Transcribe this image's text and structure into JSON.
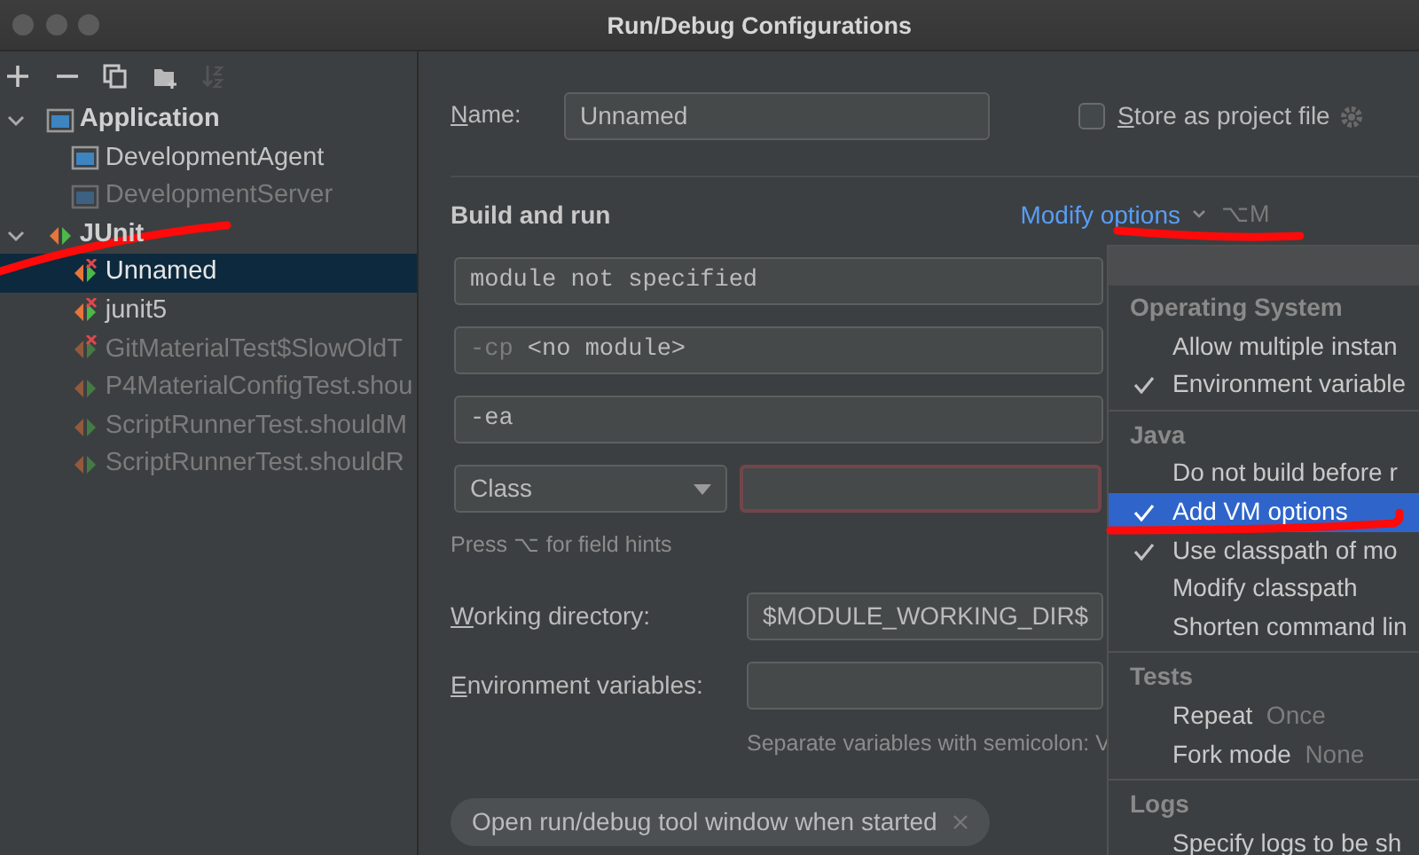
{
  "window": {
    "title": "Run/Debug Configurations"
  },
  "toolbar": [
    {
      "kind": "add",
      "disabled": false
    },
    {
      "kind": "remove",
      "disabled": false
    },
    {
      "kind": "copy",
      "disabled": false
    },
    {
      "kind": "folder",
      "disabled": false
    },
    {
      "kind": "sort",
      "disabled": true
    }
  ],
  "tree": [
    {
      "label": "Application",
      "kind": "application",
      "expanded": true,
      "children": [
        {
          "label": "DevelopmentAgent",
          "kind": "application",
          "dimmed": false,
          "error": false,
          "selected": false
        },
        {
          "label": "DevelopmentServer",
          "kind": "application",
          "dimmed": true,
          "error": false,
          "selected": false
        }
      ]
    },
    {
      "label": "JUnit",
      "kind": "junit",
      "expanded": true,
      "children": [
        {
          "label": "Unnamed",
          "kind": "junit",
          "dimmed": false,
          "error": true,
          "selected": true
        },
        {
          "label": "junit5",
          "kind": "junit",
          "dimmed": false,
          "error": true,
          "selected": false
        },
        {
          "label": "GitMaterialTest$SlowOldT",
          "kind": "junit",
          "dimmed": true,
          "error": true,
          "selected": false
        },
        {
          "label": "P4MaterialConfigTest.shou",
          "kind": "junit",
          "dimmed": true,
          "error": false,
          "selected": false
        },
        {
          "label": "ScriptRunnerTest.shouldM",
          "kind": "junit",
          "dimmed": true,
          "error": false,
          "selected": false
        },
        {
          "label": "ScriptRunnerTest.shouldR",
          "kind": "junit",
          "dimmed": true,
          "error": false,
          "selected": false
        }
      ]
    }
  ],
  "form": {
    "name": {
      "label": "Name:",
      "value": "Unnamed"
    },
    "store": {
      "label": "Store as project file",
      "checked": false
    },
    "section": "Build and run",
    "modify": {
      "label": "Modify options",
      "shortcut": "⌥M"
    },
    "module": "module not specified",
    "classpath": {
      "prefix": "-cp",
      "value": "<no module>"
    },
    "vm_options": "-ea",
    "target": {
      "value": "Class",
      "error": true
    },
    "field_hint": "Press ⌥ for field hints",
    "working_dir": {
      "label": "Working directory:",
      "value": "$MODULE_WORKING_DIR$"
    },
    "env": {
      "label": "Environment variables:",
      "hint": "Separate variables with semicolon: V"
    },
    "chips": [
      {
        "label": "Open run/debug tool window when started"
      }
    ]
  },
  "menu": {
    "groups": [
      {
        "title": "Operating System",
        "items": [
          {
            "label": "Allow multiple instan",
            "checked": false,
            "selected": false
          },
          {
            "label": "Environment variable",
            "checked": true,
            "selected": false
          }
        ]
      },
      {
        "title": "Java",
        "items": [
          {
            "label": "Do not build before r",
            "checked": false,
            "selected": false
          },
          {
            "label": "Add VM options",
            "checked": true,
            "selected": true
          },
          {
            "label": "Use classpath of mo",
            "checked": true,
            "selected": false
          },
          {
            "label": "Modify classpath",
            "checked": false,
            "selected": false
          },
          {
            "label": "Shorten command lin",
            "checked": false,
            "selected": false
          }
        ]
      },
      {
        "title": "Tests",
        "items": [
          {
            "label": "Repeat",
            "value": "Once",
            "checked": false,
            "selected": false
          },
          {
            "label": "Fork mode",
            "value": "None",
            "checked": false,
            "selected": false
          }
        ]
      },
      {
        "title": "Logs",
        "items": [
          {
            "label": "Specify logs to be sh",
            "checked": false,
            "selected": false
          }
        ]
      }
    ]
  }
}
